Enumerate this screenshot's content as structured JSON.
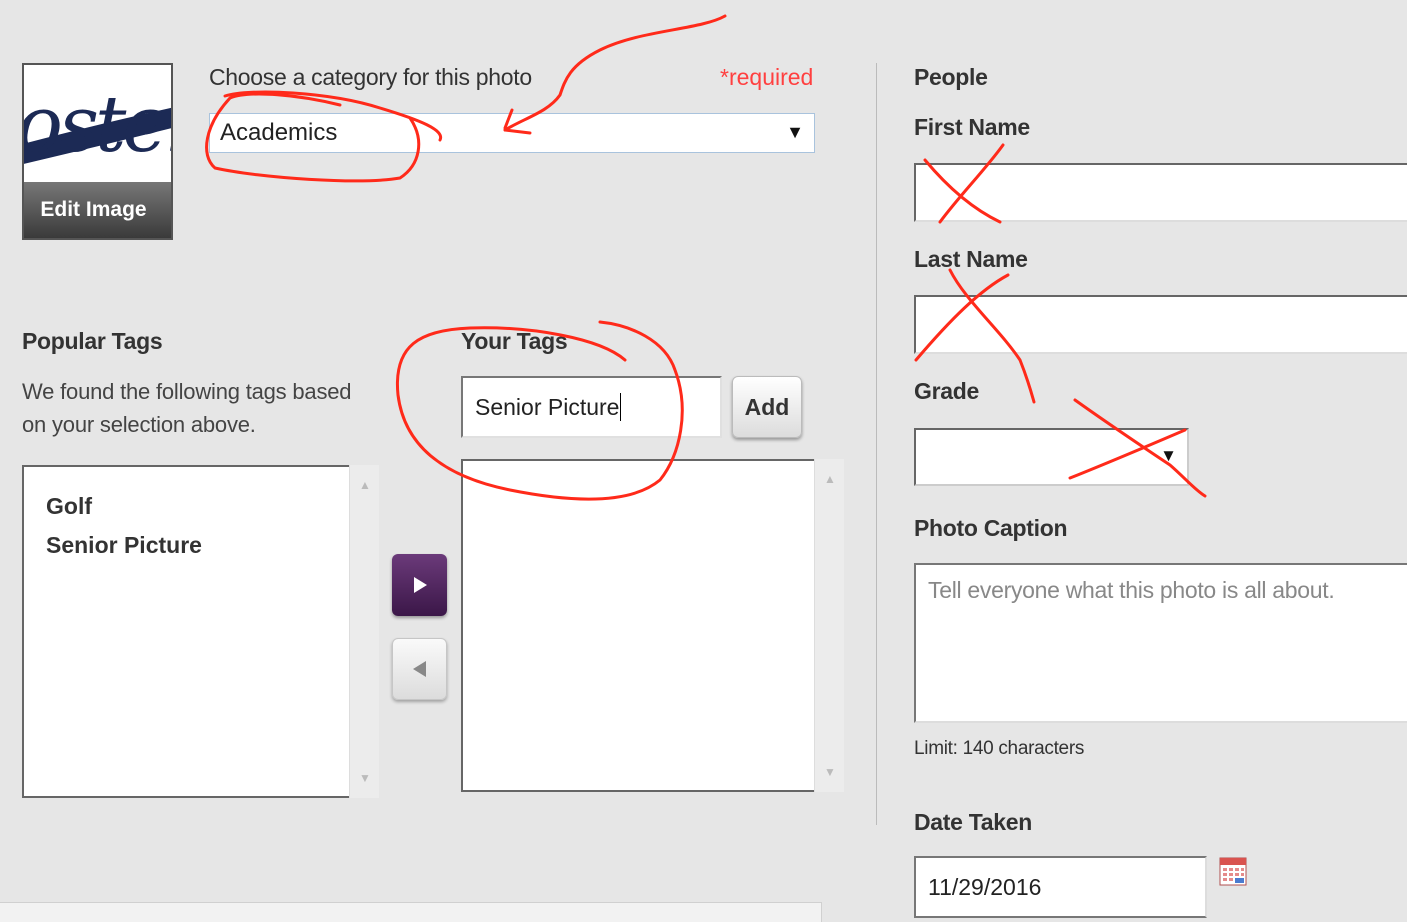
{
  "image": {
    "edit_label": "Edit Image",
    "logo_text": "Foster"
  },
  "category": {
    "label": "Choose a category for this photo",
    "required": "*required",
    "selected": "Academics"
  },
  "popular_tags": {
    "title": "Popular Tags",
    "description_line1": "We found the following tags based",
    "description_line2": "on your selection above.",
    "items": [
      "Golf",
      "Senior Picture"
    ]
  },
  "your_tags": {
    "title": "Your Tags",
    "input_value": "Senior Picture",
    "add_label": "Add",
    "items": []
  },
  "people": {
    "title": "People",
    "first_name_label": "First Name",
    "first_name_value": "",
    "last_name_label": "Last Name",
    "last_name_value": "",
    "grade_label": "Grade",
    "grade_value": ""
  },
  "caption": {
    "label": "Photo Caption",
    "placeholder": "Tell everyone what this photo is all about.",
    "limit": "Limit: 140 characters"
  },
  "date_taken": {
    "label": "Date Taken",
    "value": "11/29/2016"
  },
  "icons": {
    "move_right": "play-right-icon",
    "move_left": "play-left-icon",
    "calendar": "calendar-icon",
    "dropdown": "chevron-down-icon"
  },
  "colors": {
    "annotation": "#ff2a1a",
    "required": "#ff4040",
    "move_button": "#4b2159"
  }
}
